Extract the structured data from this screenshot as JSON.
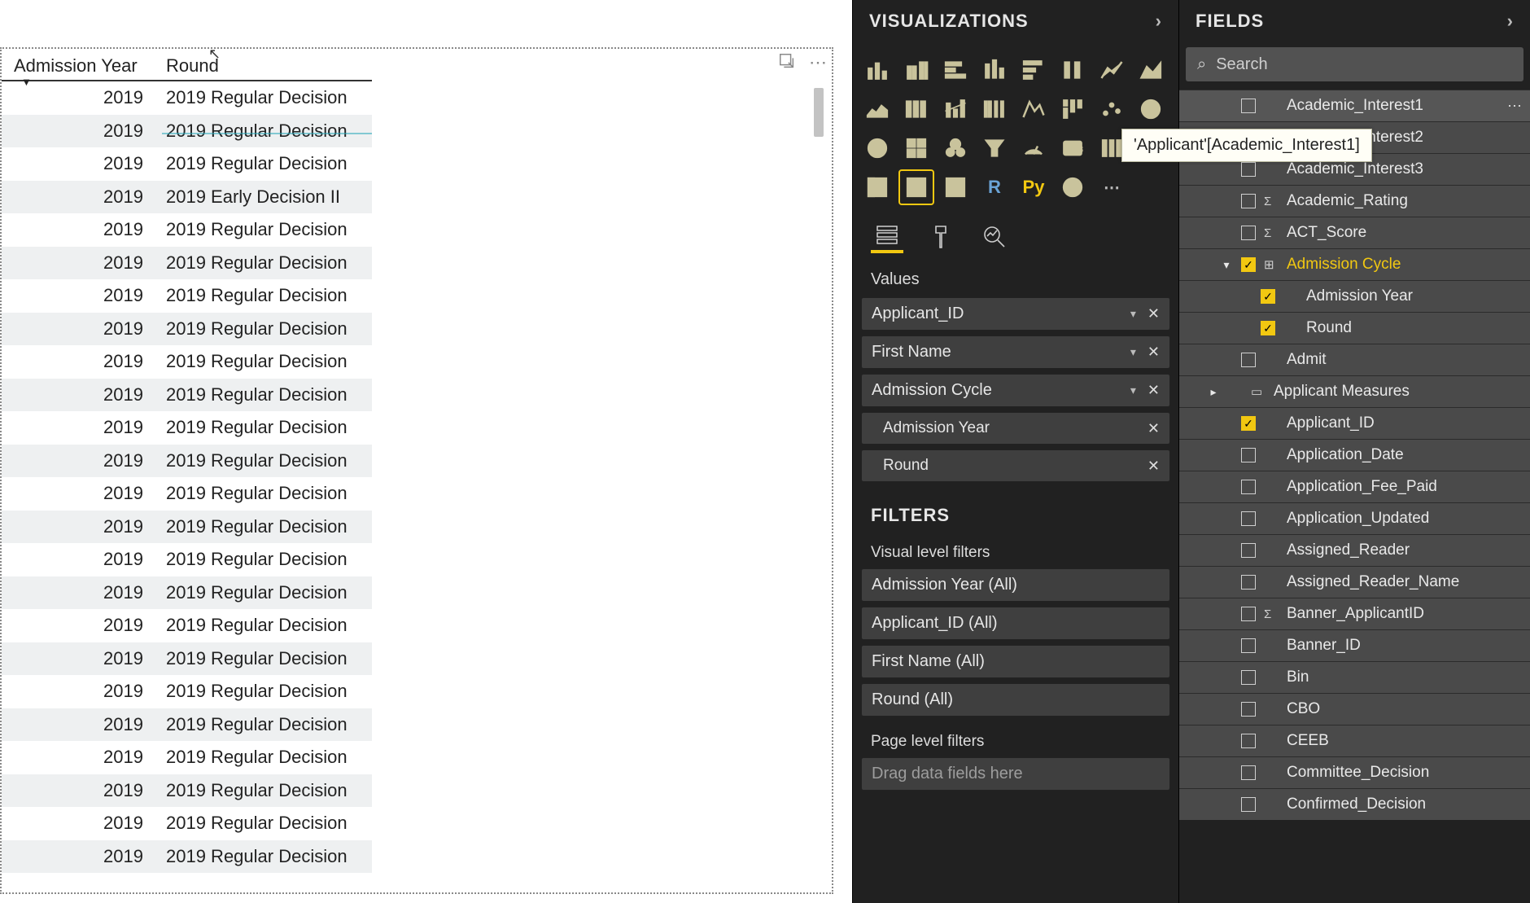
{
  "table": {
    "headers": [
      "Admission Year",
      "Round"
    ],
    "rows": [
      [
        "2019",
        "2019 Regular Decision"
      ],
      [
        "2019",
        "2019 Regular Decision"
      ],
      [
        "2019",
        "2019 Regular Decision"
      ],
      [
        "2019",
        "2019 Early Decision II"
      ],
      [
        "2019",
        "2019 Regular Decision"
      ],
      [
        "2019",
        "2019 Regular Decision"
      ],
      [
        "2019",
        "2019 Regular Decision"
      ],
      [
        "2019",
        "2019 Regular Decision"
      ],
      [
        "2019",
        "2019 Regular Decision"
      ],
      [
        "2019",
        "2019 Regular Decision"
      ],
      [
        "2019",
        "2019 Regular Decision"
      ],
      [
        "2019",
        "2019 Regular Decision"
      ],
      [
        "2019",
        "2019 Regular Decision"
      ],
      [
        "2019",
        "2019 Regular Decision"
      ],
      [
        "2019",
        "2019 Regular Decision"
      ],
      [
        "2019",
        "2019 Regular Decision"
      ],
      [
        "2019",
        "2019 Regular Decision"
      ],
      [
        "2019",
        "2019 Regular Decision"
      ],
      [
        "2019",
        "2019 Regular Decision"
      ],
      [
        "2019",
        "2019 Regular Decision"
      ],
      [
        "2019",
        "2019 Regular Decision"
      ],
      [
        "2019",
        "2019 Regular Decision"
      ],
      [
        "2019",
        "2019 Regular Decision"
      ],
      [
        "2019",
        "2019 Regular Decision"
      ]
    ]
  },
  "vis": {
    "title": "VISUALIZATIONS",
    "values_label": "Values",
    "values": [
      {
        "name": "Applicant_ID",
        "dd": true,
        "x": true
      },
      {
        "name": "First Name",
        "dd": true,
        "x": true
      },
      {
        "name": "Admission Cycle",
        "dd": true,
        "x": true
      },
      {
        "name": "Admission Year",
        "dd": false,
        "x": true,
        "sub": true
      },
      {
        "name": "Round",
        "dd": false,
        "x": true,
        "sub": true
      }
    ],
    "filters_title": "FILTERS",
    "visual_filters_label": "Visual level filters",
    "visual_filters": [
      "Admission Year (All)",
      "Applicant_ID (All)",
      "First Name (All)",
      "Round (All)"
    ],
    "page_filters_label": "Page level filters",
    "drag_hint": "Drag data fields here"
  },
  "fields": {
    "title": "FIELDS",
    "search_ph": "Search",
    "tooltip": "'Applicant'[Academic_Interest1]",
    "items": [
      {
        "lvl": 1,
        "exp": "",
        "cb": false,
        "ico": "",
        "label": "Academic_Interest1",
        "hover": true,
        "more": true
      },
      {
        "lvl": 1,
        "exp": "",
        "cb": false,
        "ico": "",
        "label": "Academic_Interest2"
      },
      {
        "lvl": 1,
        "exp": "",
        "cb": false,
        "ico": "",
        "label": "Academic_Interest3"
      },
      {
        "lvl": 1,
        "exp": "",
        "cb": false,
        "ico": "Σ",
        "label": "Academic_Rating"
      },
      {
        "lvl": 1,
        "exp": "",
        "cb": false,
        "ico": "Σ",
        "label": "ACT_Score"
      },
      {
        "lvl": 1,
        "exp": "▾",
        "cb": true,
        "ico": "⊞",
        "label": "Admission Cycle",
        "hi": true
      },
      {
        "lvl": 2,
        "exp": "",
        "cb": true,
        "ico": "",
        "label": "Admission Year"
      },
      {
        "lvl": 2,
        "exp": "",
        "cb": true,
        "ico": "",
        "label": "Round"
      },
      {
        "lvl": 1,
        "exp": "",
        "cb": false,
        "ico": "",
        "label": "Admit"
      },
      {
        "lvl": 0,
        "exp": "▸",
        "cb": null,
        "ico": "▭",
        "label": "Applicant Measures"
      },
      {
        "lvl": 1,
        "exp": "",
        "cb": true,
        "ico": "",
        "label": "Applicant_ID"
      },
      {
        "lvl": 1,
        "exp": "",
        "cb": false,
        "ico": "",
        "label": "Application_Date"
      },
      {
        "lvl": 1,
        "exp": "",
        "cb": false,
        "ico": "",
        "label": "Application_Fee_Paid"
      },
      {
        "lvl": 1,
        "exp": "",
        "cb": false,
        "ico": "",
        "label": "Application_Updated"
      },
      {
        "lvl": 1,
        "exp": "",
        "cb": false,
        "ico": "",
        "label": "Assigned_Reader"
      },
      {
        "lvl": 1,
        "exp": "",
        "cb": false,
        "ico": "",
        "label": "Assigned_Reader_Name"
      },
      {
        "lvl": 1,
        "exp": "",
        "cb": false,
        "ico": "Σ",
        "label": "Banner_ApplicantID"
      },
      {
        "lvl": 1,
        "exp": "",
        "cb": false,
        "ico": "",
        "label": "Banner_ID"
      },
      {
        "lvl": 1,
        "exp": "",
        "cb": false,
        "ico": "",
        "label": "Bin"
      },
      {
        "lvl": 1,
        "exp": "",
        "cb": false,
        "ico": "",
        "label": "CBO"
      },
      {
        "lvl": 1,
        "exp": "",
        "cb": false,
        "ico": "",
        "label": "CEEB"
      },
      {
        "lvl": 1,
        "exp": "",
        "cb": false,
        "ico": "",
        "label": "Committee_Decision"
      },
      {
        "lvl": 1,
        "exp": "",
        "cb": false,
        "ico": "",
        "label": "Confirmed_Decision"
      }
    ]
  }
}
